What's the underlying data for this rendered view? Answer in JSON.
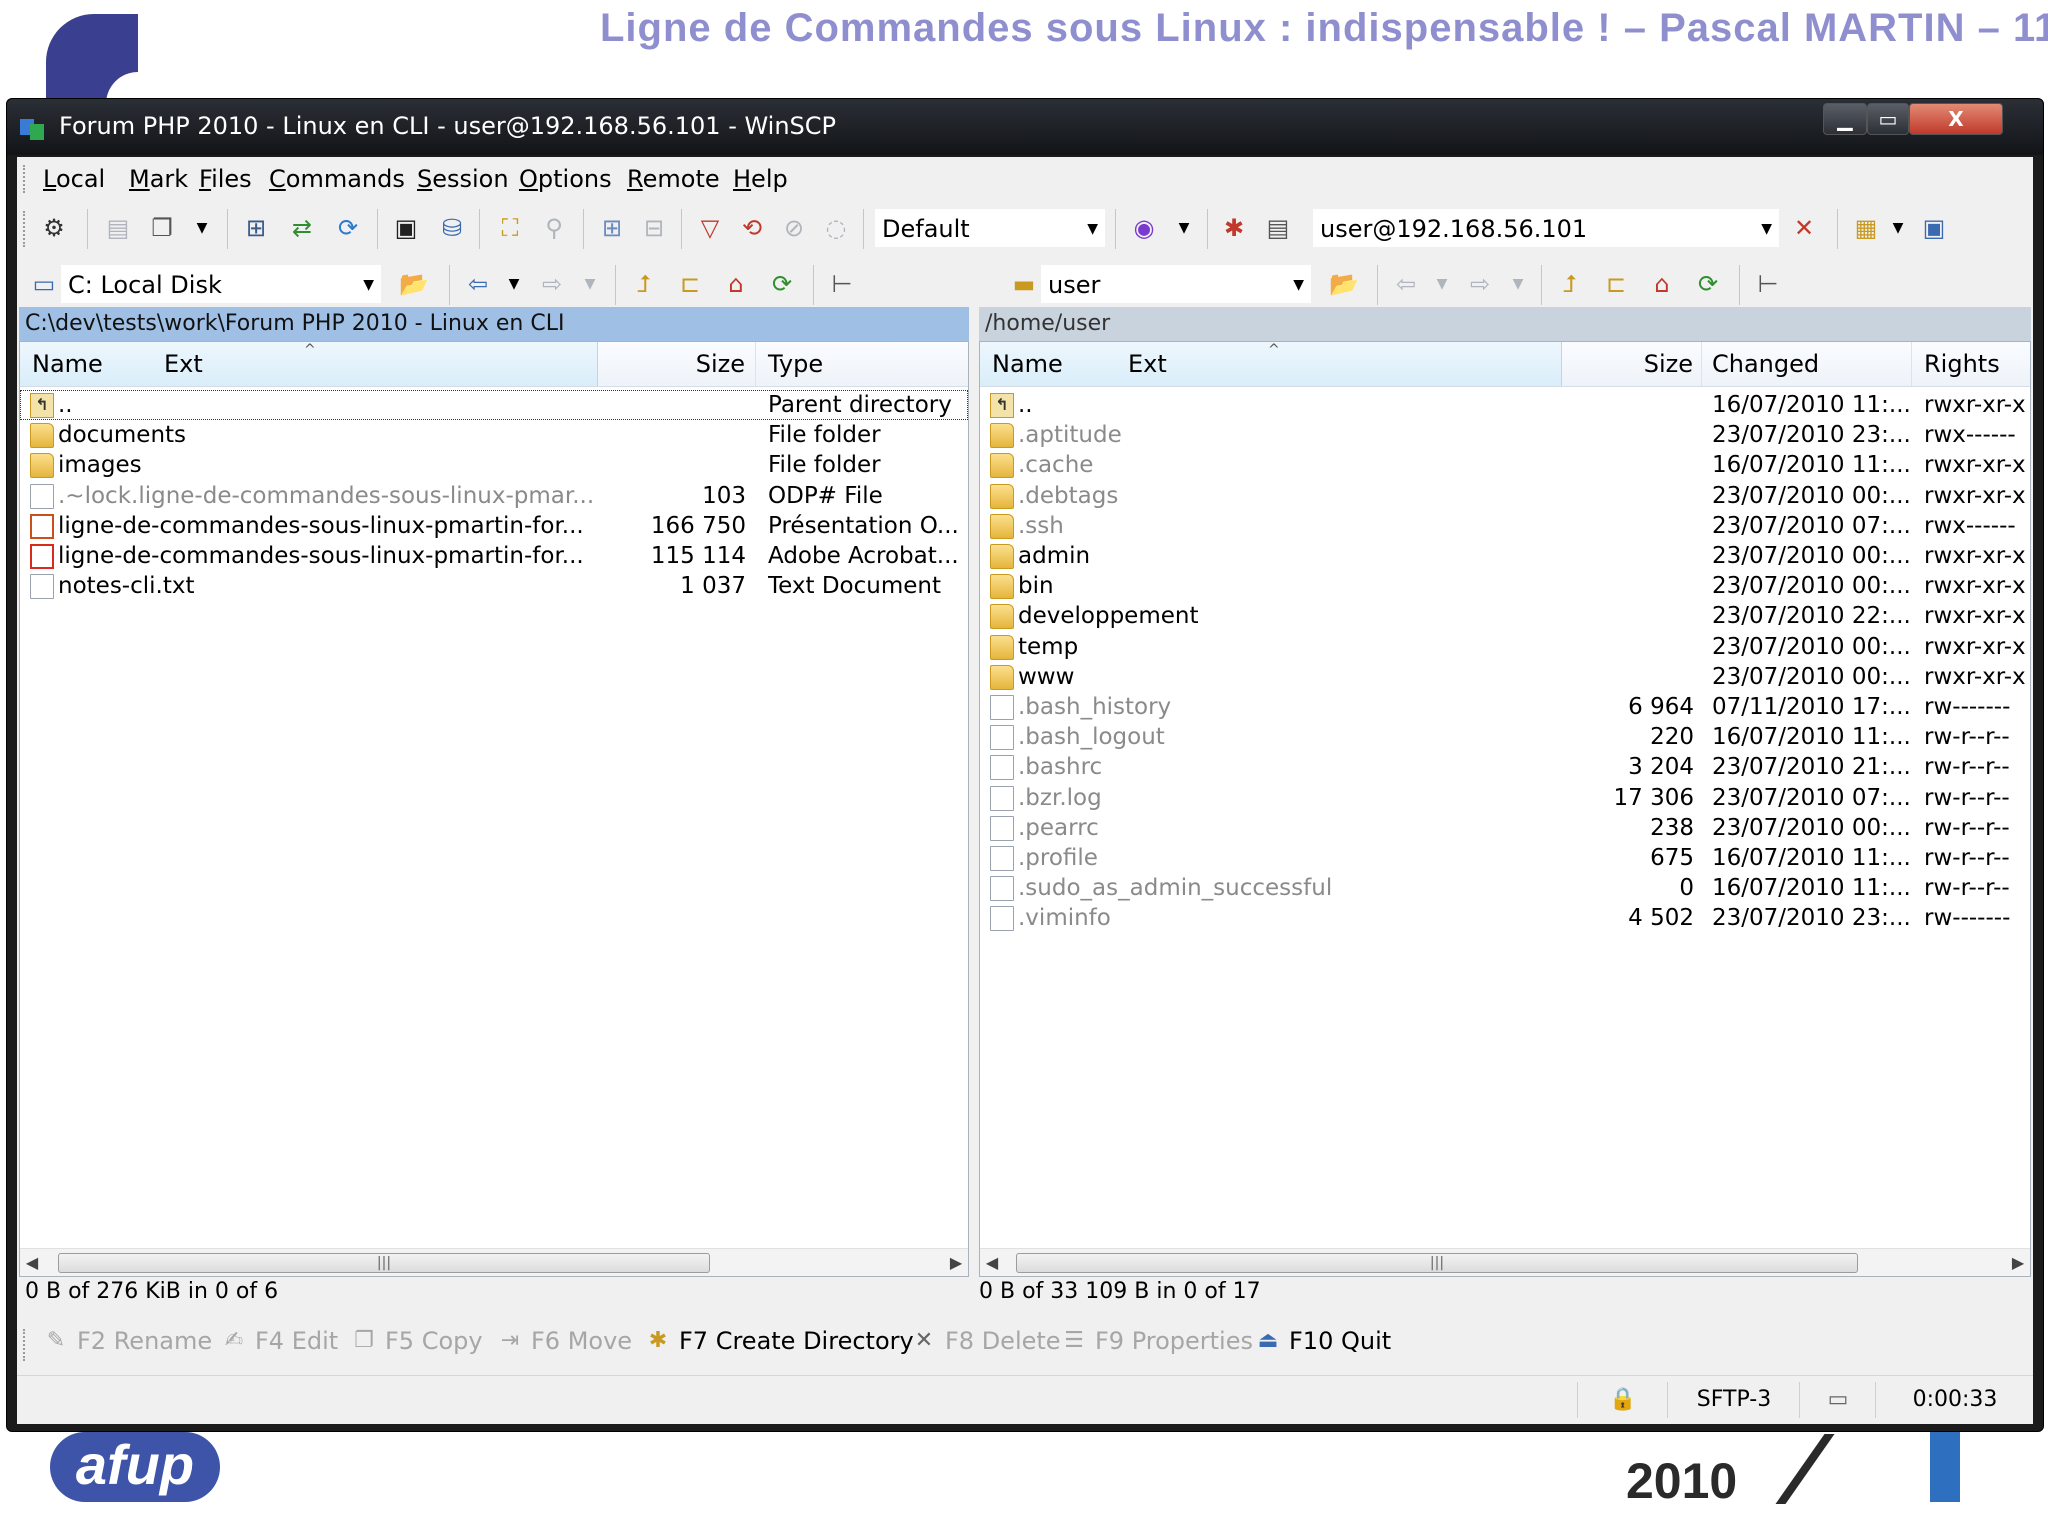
{
  "slide": {
    "title": "Ligne de Commandes sous Linux : indispensable ! – Pascal MARTIN – 11",
    "footer_logo_text": "afup",
    "footer_year": "2010"
  },
  "window": {
    "title": "Forum PHP 2010 - Linux en CLI - user@192.168.56.101 - WinSCP",
    "minimize_glyph": "▁",
    "maximize_glyph": "▭",
    "close_glyph": "X"
  },
  "menu": [
    "Local",
    "Mark",
    "Files",
    "Commands",
    "Session",
    "Options",
    "Remote",
    "Help"
  ],
  "toolbar": {
    "transfer_preset": "Default",
    "session": "user@192.168.56.101"
  },
  "left_panel": {
    "drive": "C: Local Disk",
    "path": "C:\\dev\\tests\\work\\Forum PHP 2010 - Linux en CLI",
    "columns": {
      "name": "Name",
      "ext": "Ext",
      "size": "Size",
      "type": "Type"
    },
    "files": [
      {
        "icon": "parent-directory-icon",
        "name": "..",
        "size": "",
        "type": "Parent directory"
      },
      {
        "icon": "folder-icon",
        "name": "documents",
        "size": "",
        "type": "File folder"
      },
      {
        "icon": "folder-icon",
        "name": "images",
        "size": "",
        "type": "File folder"
      },
      {
        "icon": "file-icon",
        "name": ".~lock.ligne-de-commandes-sous-linux-pmar...",
        "size": "103",
        "type": "ODP# File",
        "dim": true
      },
      {
        "icon": "presentation-file-icon",
        "name": "ligne-de-commandes-sous-linux-pmartin-for...",
        "size": "166 750",
        "type": "Présentation O..."
      },
      {
        "icon": "pdf-file-icon",
        "name": "ligne-de-commandes-sous-linux-pmartin-for...",
        "size": "115 114",
        "type": "Adobe Acrobat..."
      },
      {
        "icon": "text-file-icon",
        "name": "notes-cli.txt",
        "size": "1 037",
        "type": "Text Document"
      }
    ],
    "summary": "0 B of 276 KiB in 0 of 6"
  },
  "right_panel": {
    "dir": "user",
    "path": "/home/user",
    "columns": {
      "name": "Name",
      "ext": "Ext",
      "size": "Size",
      "changed": "Changed",
      "rights": "Rights"
    },
    "files": [
      {
        "icon": "parent-directory-icon",
        "name": "..",
        "size": "",
        "changed": "16/07/2010 11:...",
        "rights": "rwxr-xr-x"
      },
      {
        "icon": "folder-icon",
        "name": ".aptitude",
        "size": "",
        "changed": "23/07/2010 23:...",
        "rights": "rwx------",
        "dim": true
      },
      {
        "icon": "folder-icon",
        "name": ".cache",
        "size": "",
        "changed": "16/07/2010 11:...",
        "rights": "rwxr-xr-x",
        "dim": true
      },
      {
        "icon": "folder-icon",
        "name": ".debtags",
        "size": "",
        "changed": "23/07/2010 00:...",
        "rights": "rwxr-xr-x",
        "dim": true
      },
      {
        "icon": "folder-icon",
        "name": ".ssh",
        "size": "",
        "changed": "23/07/2010 07:...",
        "rights": "rwx------",
        "dim": true
      },
      {
        "icon": "folder-icon",
        "name": "admin",
        "size": "",
        "changed": "23/07/2010 00:...",
        "rights": "rwxr-xr-x"
      },
      {
        "icon": "folder-icon",
        "name": "bin",
        "size": "",
        "changed": "23/07/2010 00:...",
        "rights": "rwxr-xr-x"
      },
      {
        "icon": "folder-icon",
        "name": "developpement",
        "size": "",
        "changed": "23/07/2010 22:...",
        "rights": "rwxr-xr-x"
      },
      {
        "icon": "folder-icon",
        "name": "temp",
        "size": "",
        "changed": "23/07/2010 00:...",
        "rights": "rwxr-xr-x"
      },
      {
        "icon": "folder-icon",
        "name": "www",
        "size": "",
        "changed": "23/07/2010 00:...",
        "rights": "rwxr-xr-x"
      },
      {
        "icon": "file-icon",
        "name": ".bash_history",
        "size": "6 964",
        "changed": "07/11/2010 17:...",
        "rights": "rw-------",
        "dim": true
      },
      {
        "icon": "file-icon",
        "name": ".bash_logout",
        "size": "220",
        "changed": "16/07/2010 11:...",
        "rights": "rw-r--r--",
        "dim": true
      },
      {
        "icon": "file-icon",
        "name": ".bashrc",
        "size": "3 204",
        "changed": "23/07/2010 21:...",
        "rights": "rw-r--r--",
        "dim": true
      },
      {
        "icon": "text-file-icon",
        "name": ".bzr.log",
        "size": "17 306",
        "changed": "23/07/2010 07:...",
        "rights": "rw-r--r--",
        "dim": true
      },
      {
        "icon": "file-icon",
        "name": ".pearrc",
        "size": "238",
        "changed": "23/07/2010 00:...",
        "rights": "rw-r--r--",
        "dim": true
      },
      {
        "icon": "file-icon",
        "name": ".profile",
        "size": "675",
        "changed": "16/07/2010 11:...",
        "rights": "rw-r--r--",
        "dim": true
      },
      {
        "icon": "file-icon",
        "name": ".sudo_as_admin_successful",
        "size": "0",
        "changed": "16/07/2010 11:...",
        "rights": "rw-r--r--",
        "dim": true
      },
      {
        "icon": "file-icon",
        "name": ".viminfo",
        "size": "4 502",
        "changed": "23/07/2010 23:...",
        "rights": "rw-------",
        "dim": true
      }
    ],
    "summary": "0 B of 33 109 B in 0 of 17"
  },
  "fkeys": [
    {
      "label": "F2 Rename",
      "icon": "rename-icon",
      "enabled": false
    },
    {
      "label": "F4 Edit",
      "icon": "edit-icon",
      "enabled": false
    },
    {
      "label": "F5 Copy",
      "icon": "copy-icon",
      "enabled": false
    },
    {
      "label": "F6 Move",
      "icon": "move-icon",
      "enabled": false
    },
    {
      "label": "F7 Create Directory",
      "icon": "create-directory-icon",
      "enabled": true
    },
    {
      "label": "F8 Delete",
      "icon": "delete-icon",
      "enabled": false
    },
    {
      "label": "F9 Properties",
      "icon": "properties-icon",
      "enabled": false
    },
    {
      "label": "F10 Quit",
      "icon": "quit-icon",
      "enabled": true
    }
  ],
  "statusbar": {
    "protocol": "SFTP-3",
    "elapsed": "0:00:33"
  },
  "colors": {
    "active_panel_header": "#9fbfe5",
    "inactive_panel_header": "#c9d3de",
    "titlebar": "#1b1b1b",
    "slide_title": "#8f8fcf"
  }
}
